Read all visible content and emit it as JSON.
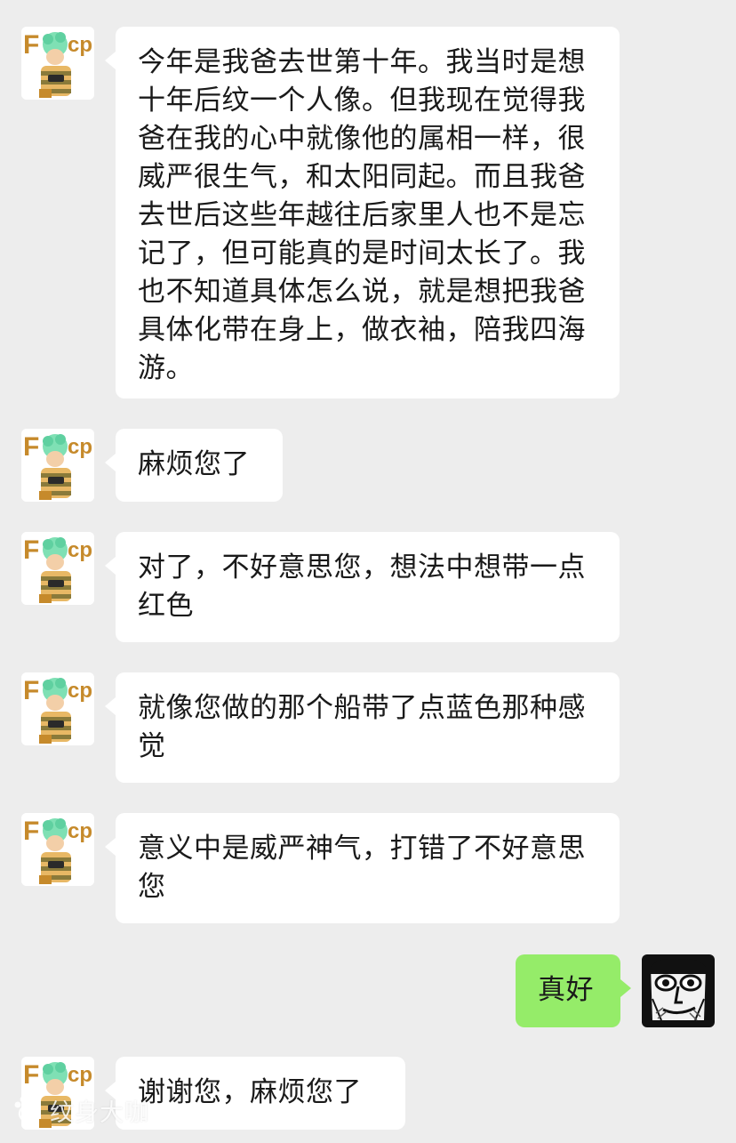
{
  "chat": {
    "messages": [
      {
        "side": "in",
        "text": "今年是我爸去世第十年。我当时是想十年后纹一个人像。但我现在觉得我爸在我的心中就像他的属相一样，很威严很生气，和太阳同起。而且我爸去世后这些年越往后家里人也不是忘记了，但可能真的是时间太长了。我也不知道具体怎么说，就是想把我爸具体化带在身上，做衣袖，陪我四海游。"
      },
      {
        "side": "in",
        "text": "麻烦您了"
      },
      {
        "side": "in",
        "text": "对了，不好意思您，想法中想带一点红色"
      },
      {
        "side": "in",
        "text": "就像您做的那个船带了点蓝色那种感觉"
      },
      {
        "side": "in",
        "text": "意义中是威严神气，打错了不好意思您"
      },
      {
        "side": "out",
        "text": "真好"
      },
      {
        "side": "in",
        "text": "谢谢您，麻烦您了"
      }
    ]
  },
  "avatars": {
    "contact_logo_text": "Fcp",
    "contact_icon": "cartoon-boy-avatar-icon",
    "self_icon": "sketch-face-avatar-icon"
  },
  "watermark": {
    "text": "纹身大咖",
    "icon": "paw-logo-icon"
  },
  "colors": {
    "background": "#ededed",
    "incoming_bubble": "#ffffff",
    "outgoing_bubble": "#95ec69",
    "text": "#1a1a1a"
  }
}
